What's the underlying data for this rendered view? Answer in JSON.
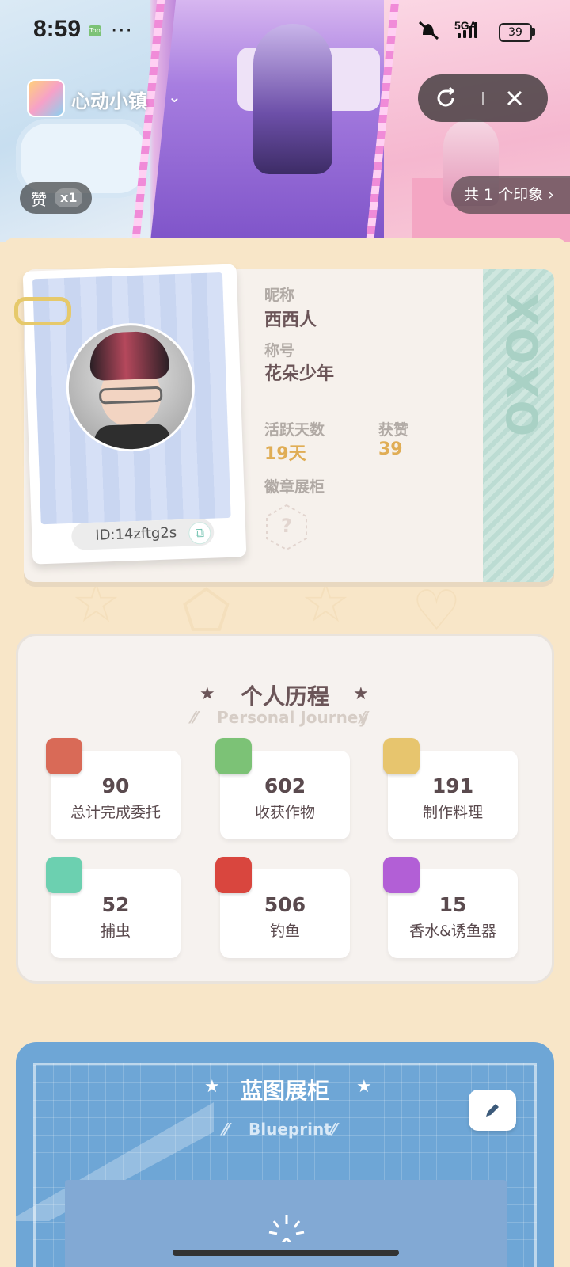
{
  "status_bar": {
    "time": "8:59",
    "mini_badge": "Top",
    "more": "···",
    "network": "5GA",
    "battery": "39"
  },
  "header": {
    "app_name": "心动小镇",
    "likes_label": "赞",
    "likes_count": "x1",
    "impressions": "共 1 个印象 ›"
  },
  "profile": {
    "nickname_label": "昵称",
    "nickname": "西西人",
    "title_label": "称号",
    "title": "花朵少年",
    "active_days_label": "活跃天数",
    "active_days": "19天",
    "likes_label": "获赞",
    "likes": "39",
    "badges_label": "徽章展柜",
    "badge_placeholder": "?",
    "id": "ID:14zftg2s",
    "ticket_word": "XOXO"
  },
  "journey": {
    "title": "个人历程",
    "subtitle": "Personal Journey",
    "stats": [
      {
        "value": "90",
        "label": "总计完成委托",
        "icon": "calendar-icon"
      },
      {
        "value": "602",
        "label": "收获作物",
        "icon": "watering-can-icon"
      },
      {
        "value": "191",
        "label": "制作料理",
        "icon": "stove-icon"
      },
      {
        "value": "52",
        "label": "捕虫",
        "icon": "bug-net-icon"
      },
      {
        "value": "506",
        "label": "钓鱼",
        "icon": "fishing-rod-icon"
      },
      {
        "value": "15",
        "label": "香水&诱鱼器",
        "icon": "perfume-bottle-icon"
      }
    ]
  },
  "blueprint": {
    "title": "蓝图展柜",
    "subtitle": "Blueprint",
    "edit_icon": "pencil-icon"
  },
  "colors": {
    "accent_gold": "#e0ad55",
    "text_brown": "#6b5558",
    "blueprint_blue": "#6ea6d6",
    "sheet_bg": "#f8e6c8"
  }
}
